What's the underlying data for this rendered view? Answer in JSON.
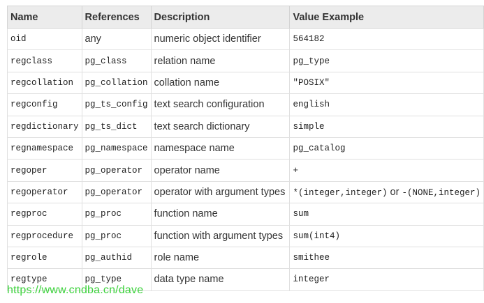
{
  "headers": [
    "Name",
    "References",
    "Description",
    "Value Example"
  ],
  "rows": [
    {
      "name": "oid",
      "references": "any",
      "description": "numeric object identifier",
      "example": "564182"
    },
    {
      "name": "regclass",
      "references": "pg_class",
      "description": "relation name",
      "example": "pg_type"
    },
    {
      "name": "regcollation",
      "references": "pg_collation",
      "description": "collation name",
      "example": "\"POSIX\""
    },
    {
      "name": "regconfig",
      "references": "pg_ts_config",
      "description": "text search configuration",
      "example": "english"
    },
    {
      "name": "regdictionary",
      "references": "pg_ts_dict",
      "description": "text search dictionary",
      "example": "simple"
    },
    {
      "name": "regnamespace",
      "references": "pg_namespace",
      "description": "namespace name",
      "example": "pg_catalog"
    },
    {
      "name": "regoper",
      "references": "pg_operator",
      "description": "operator name",
      "example": "+"
    },
    {
      "name": "regoperator",
      "references": "pg_operator",
      "description": "operator with argument types",
      "example_parts": [
        "*(integer,integer)",
        " or ",
        "-(NONE,integer)"
      ]
    },
    {
      "name": "regproc",
      "references": "pg_proc",
      "description": "function name",
      "example": "sum"
    },
    {
      "name": "regprocedure",
      "references": "pg_proc",
      "description": "function with argument types",
      "example": "sum(int4)"
    },
    {
      "name": "regrole",
      "references": "pg_authid",
      "description": "role name",
      "example": "smithee"
    },
    {
      "name": "regtype",
      "references": "pg_type",
      "description": "data type name",
      "example": "integer"
    }
  ],
  "watermark": "https://www.cndba.cn/dave",
  "colors": {
    "header_bg": "#ececec",
    "border": "#e0e0e0",
    "watermark": "#3cd23c",
    "text": "#333333"
  }
}
